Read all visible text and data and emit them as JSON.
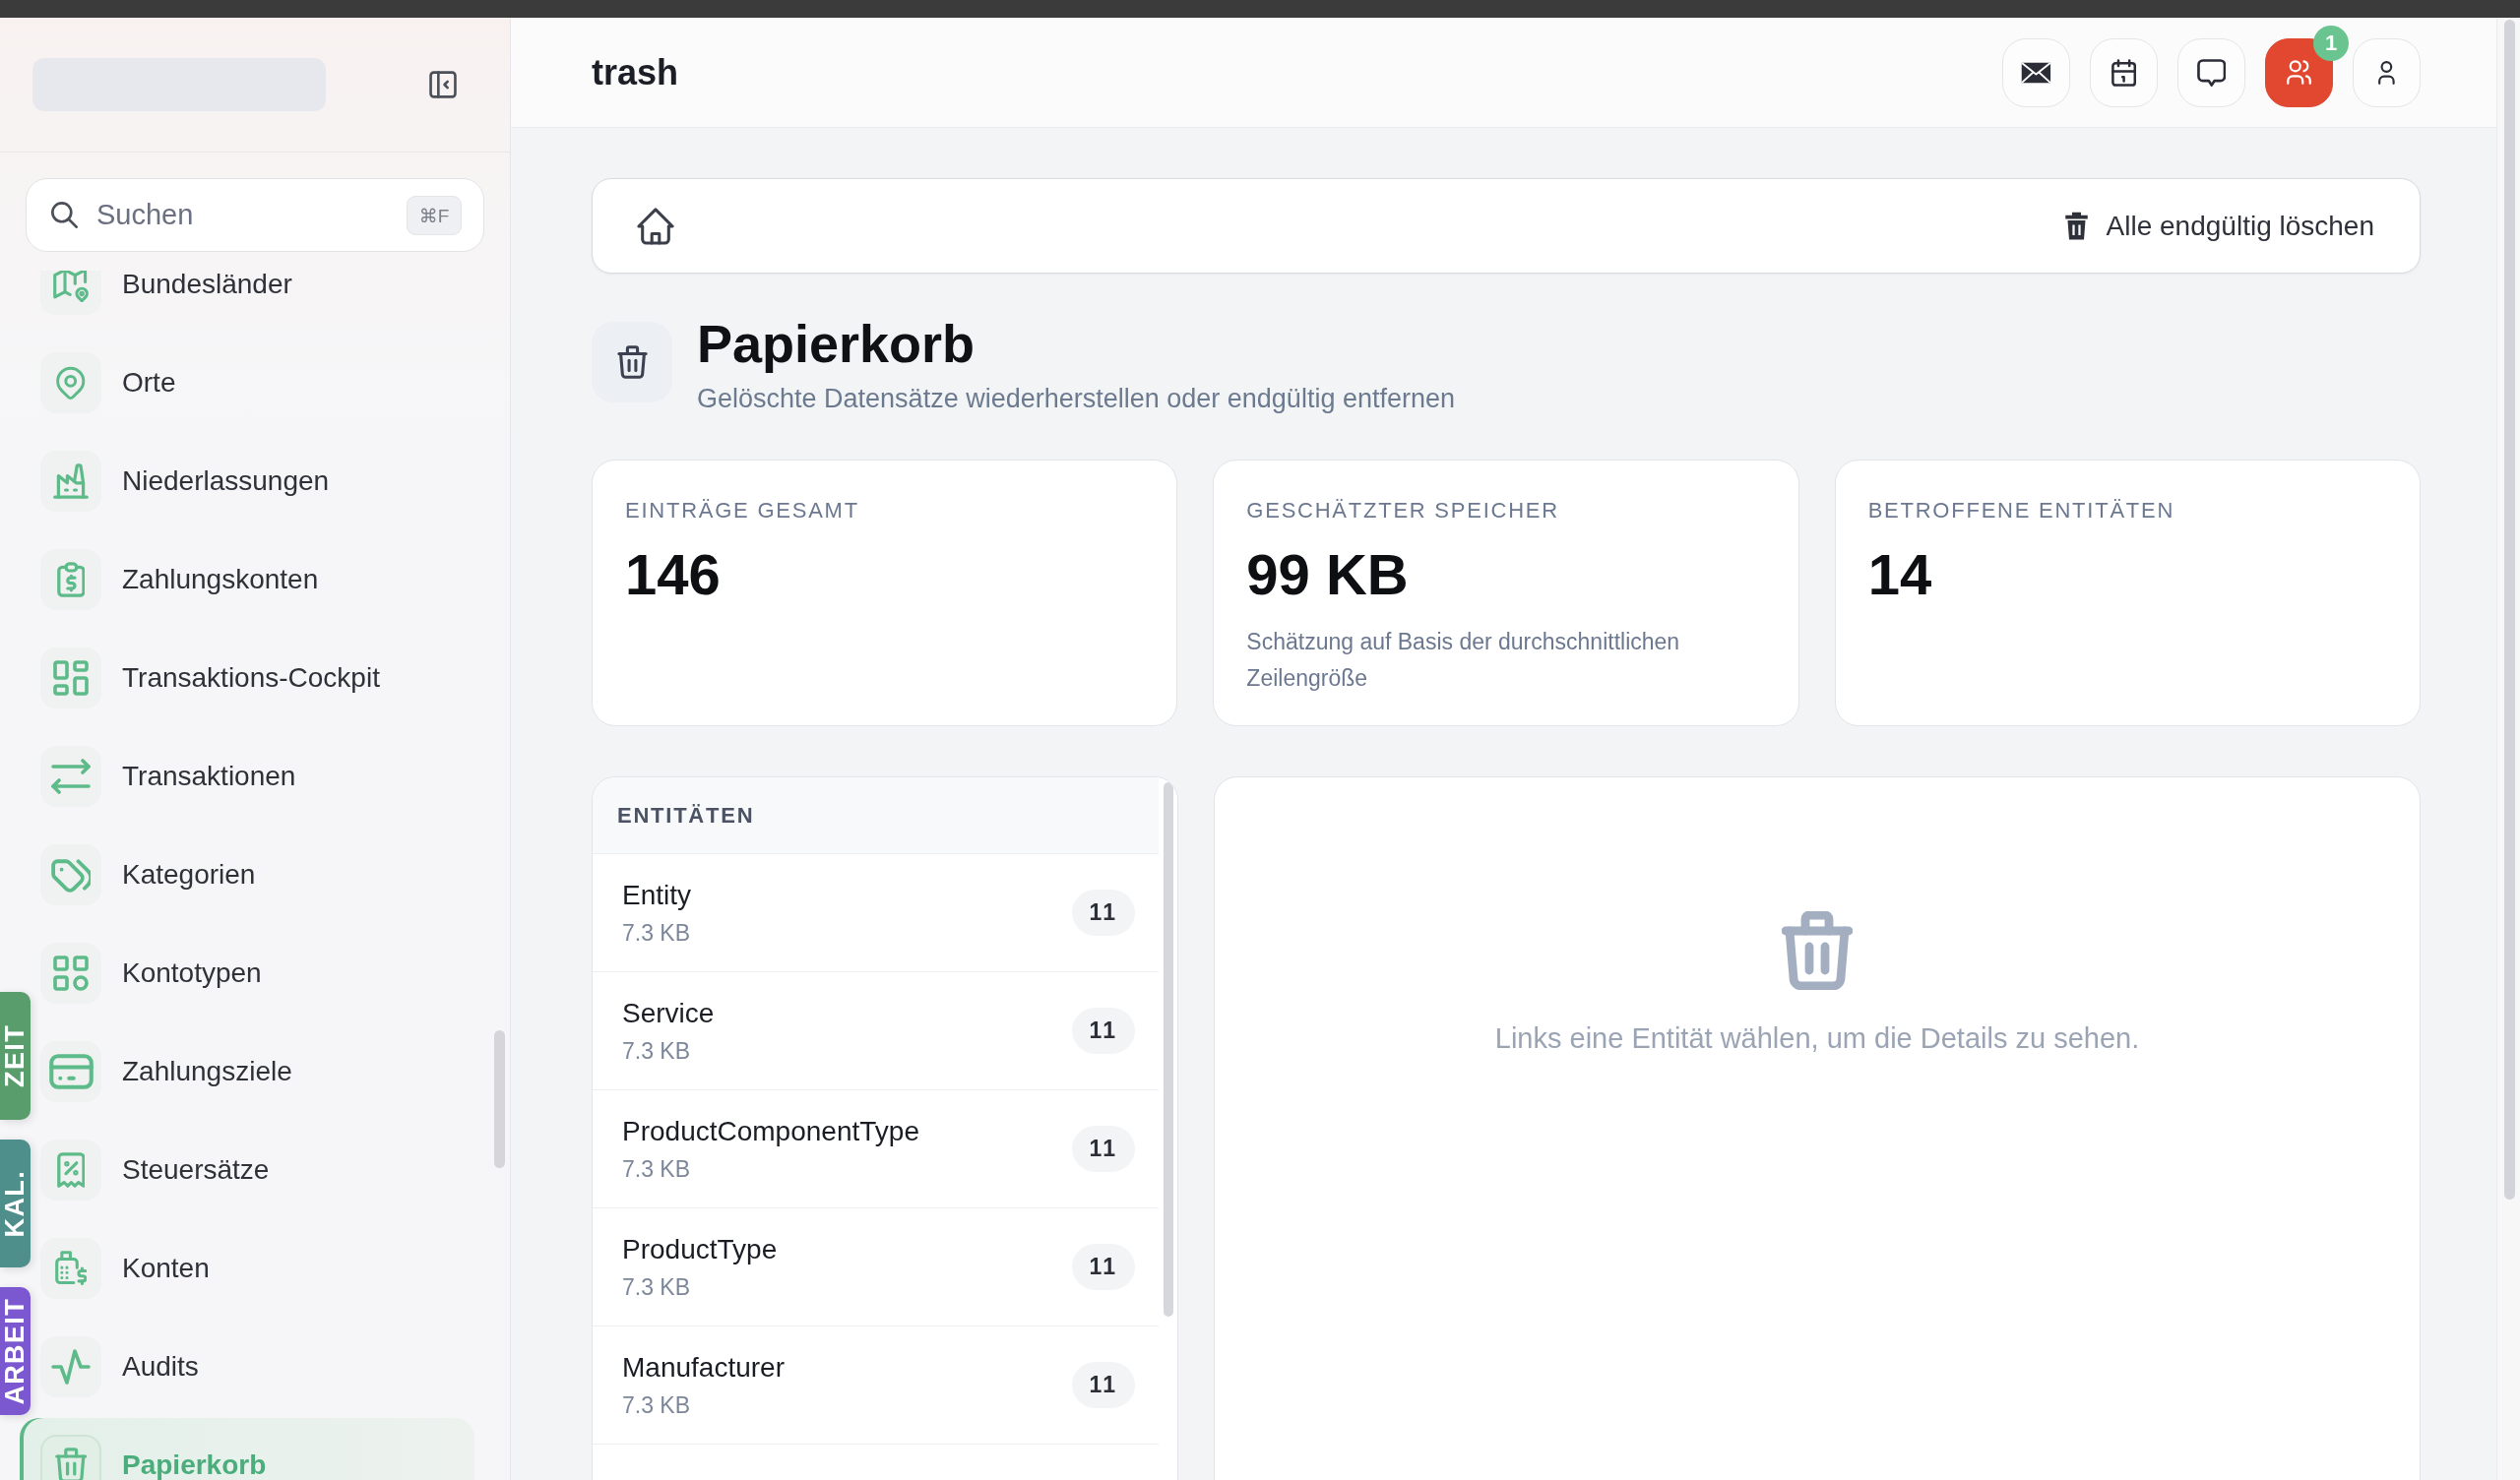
{
  "sidebar": {
    "search": {
      "placeholder": "Suchen",
      "shortcut": "⌘F"
    },
    "items": [
      {
        "label": "Bundesländer",
        "selected": false
      },
      {
        "label": "Orte",
        "selected": false
      },
      {
        "label": "Niederlassungen",
        "selected": false
      },
      {
        "label": "Zahlungskonten",
        "selected": false
      },
      {
        "label": "Transaktions-Cockpit",
        "selected": false
      },
      {
        "label": "Transaktionen",
        "selected": false
      },
      {
        "label": "Kategorien",
        "selected": false
      },
      {
        "label": "Kontotypen",
        "selected": false
      },
      {
        "label": "Zahlungsziele",
        "selected": false
      },
      {
        "label": "Steuersätze",
        "selected": false
      },
      {
        "label": "Konten",
        "selected": false
      },
      {
        "label": "Audits",
        "selected": false
      },
      {
        "label": "Papierkorb",
        "selected": true
      }
    ],
    "side_tabs": [
      {
        "label": "ZEIT",
        "color": "#5a9d6d"
      },
      {
        "label": "KAL.",
        "color": "#4e8e8b"
      },
      {
        "label": "ARBEIT",
        "color": "#7c58d0"
      }
    ]
  },
  "header": {
    "title": "trash",
    "buttons": [
      {
        "active": false
      },
      {
        "active": false
      },
      {
        "active": false
      },
      {
        "active": true,
        "badge": "1"
      },
      {
        "active": false
      }
    ]
  },
  "toolbar": {
    "action": "Alle endgültig löschen"
  },
  "page": {
    "title": "Papierkorb",
    "subtitle": "Gelöschte Datensätze wiederherstellen oder endgültig entfernen"
  },
  "stats": [
    {
      "label": "EINTRÄGE GESAMT",
      "value": "146"
    },
    {
      "label": "GESCHÄTZTER SPEICHER",
      "value": "99 KB",
      "note": "Schätzung auf Basis der durchschnittlichen Zeilengröße"
    },
    {
      "label": "BETROFFENE ENTITÄTEN",
      "value": "14"
    }
  ],
  "entities": {
    "heading": "ENTITÄTEN",
    "rows": [
      {
        "name": "Entity",
        "size": "7.3 KB",
        "count": "11",
        "selected": false
      },
      {
        "name": "Service",
        "size": "7.3 KB",
        "count": "11",
        "selected": false
      },
      {
        "name": "ProductComponentType",
        "size": "7.3 KB",
        "count": "11",
        "selected": false
      },
      {
        "name": "ProductType",
        "size": "7.3 KB",
        "count": "11",
        "selected": false
      },
      {
        "name": "Manufacturer",
        "size": "7.3 KB",
        "count": "11",
        "selected": false
      }
    ]
  },
  "detail": {
    "empty_message": "Links eine Entität wählen, um die Details zu sehen."
  }
}
